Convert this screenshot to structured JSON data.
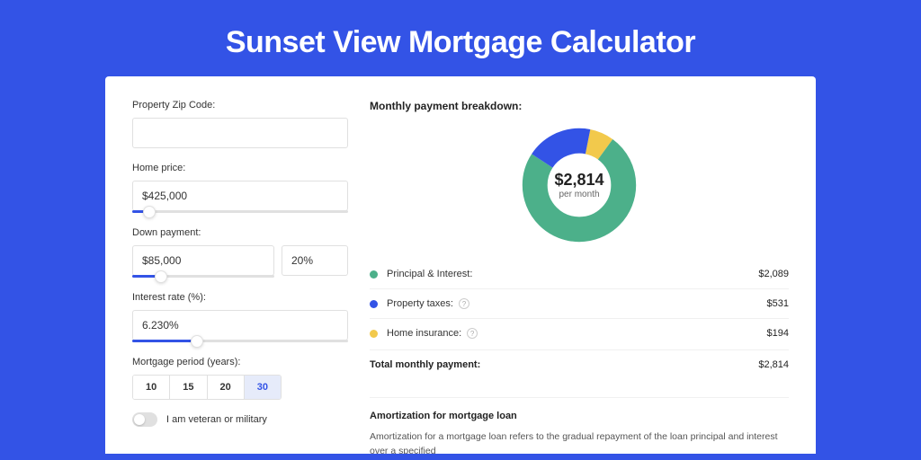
{
  "title": "Sunset View Mortgage Calculator",
  "colors": {
    "principal": "#4cb08a",
    "taxes": "#3353e6",
    "insurance": "#f2c94c"
  },
  "form": {
    "zip_label": "Property Zip Code:",
    "zip_value": "",
    "home_price_label": "Home price:",
    "home_price_value": "$425,000",
    "home_price_slider_pct": 8,
    "down_payment_label": "Down payment:",
    "down_payment_value": "$85,000",
    "down_payment_pct_value": "20%",
    "down_payment_slider_pct": 20,
    "interest_label": "Interest rate (%):",
    "interest_value": "6.230%",
    "interest_slider_pct": 30,
    "period_label": "Mortgage period (years):",
    "periods": [
      "10",
      "15",
      "20",
      "30"
    ],
    "period_active_index": 3,
    "veteran_label": "I am veteran or military",
    "veteran_on": false
  },
  "breakdown": {
    "title": "Monthly payment breakdown:",
    "center_amount": "$2,814",
    "center_caption": "per month",
    "items": [
      {
        "label": "Principal & Interest:",
        "value": "$2,089",
        "has_info": false
      },
      {
        "label": "Property taxes:",
        "value": "$531",
        "has_info": true
      },
      {
        "label": "Home insurance:",
        "value": "$194",
        "has_info": true
      }
    ],
    "total_label": "Total monthly payment:",
    "total_value": "$2,814"
  },
  "amortization": {
    "title": "Amortization for mortgage loan",
    "body": "Amortization for a mortgage loan refers to the gradual repayment of the loan principal and interest over a specified"
  },
  "chart_data": {
    "type": "pie",
    "title": "Monthly payment breakdown",
    "series": [
      {
        "name": "Principal & Interest",
        "value": 2089,
        "color": "#4cb08a"
      },
      {
        "name": "Property taxes",
        "value": 531,
        "color": "#3353e6"
      },
      {
        "name": "Home insurance",
        "value": 194,
        "color": "#f2c94c"
      }
    ],
    "total": 2814,
    "center_label": "$2,814 per month"
  }
}
